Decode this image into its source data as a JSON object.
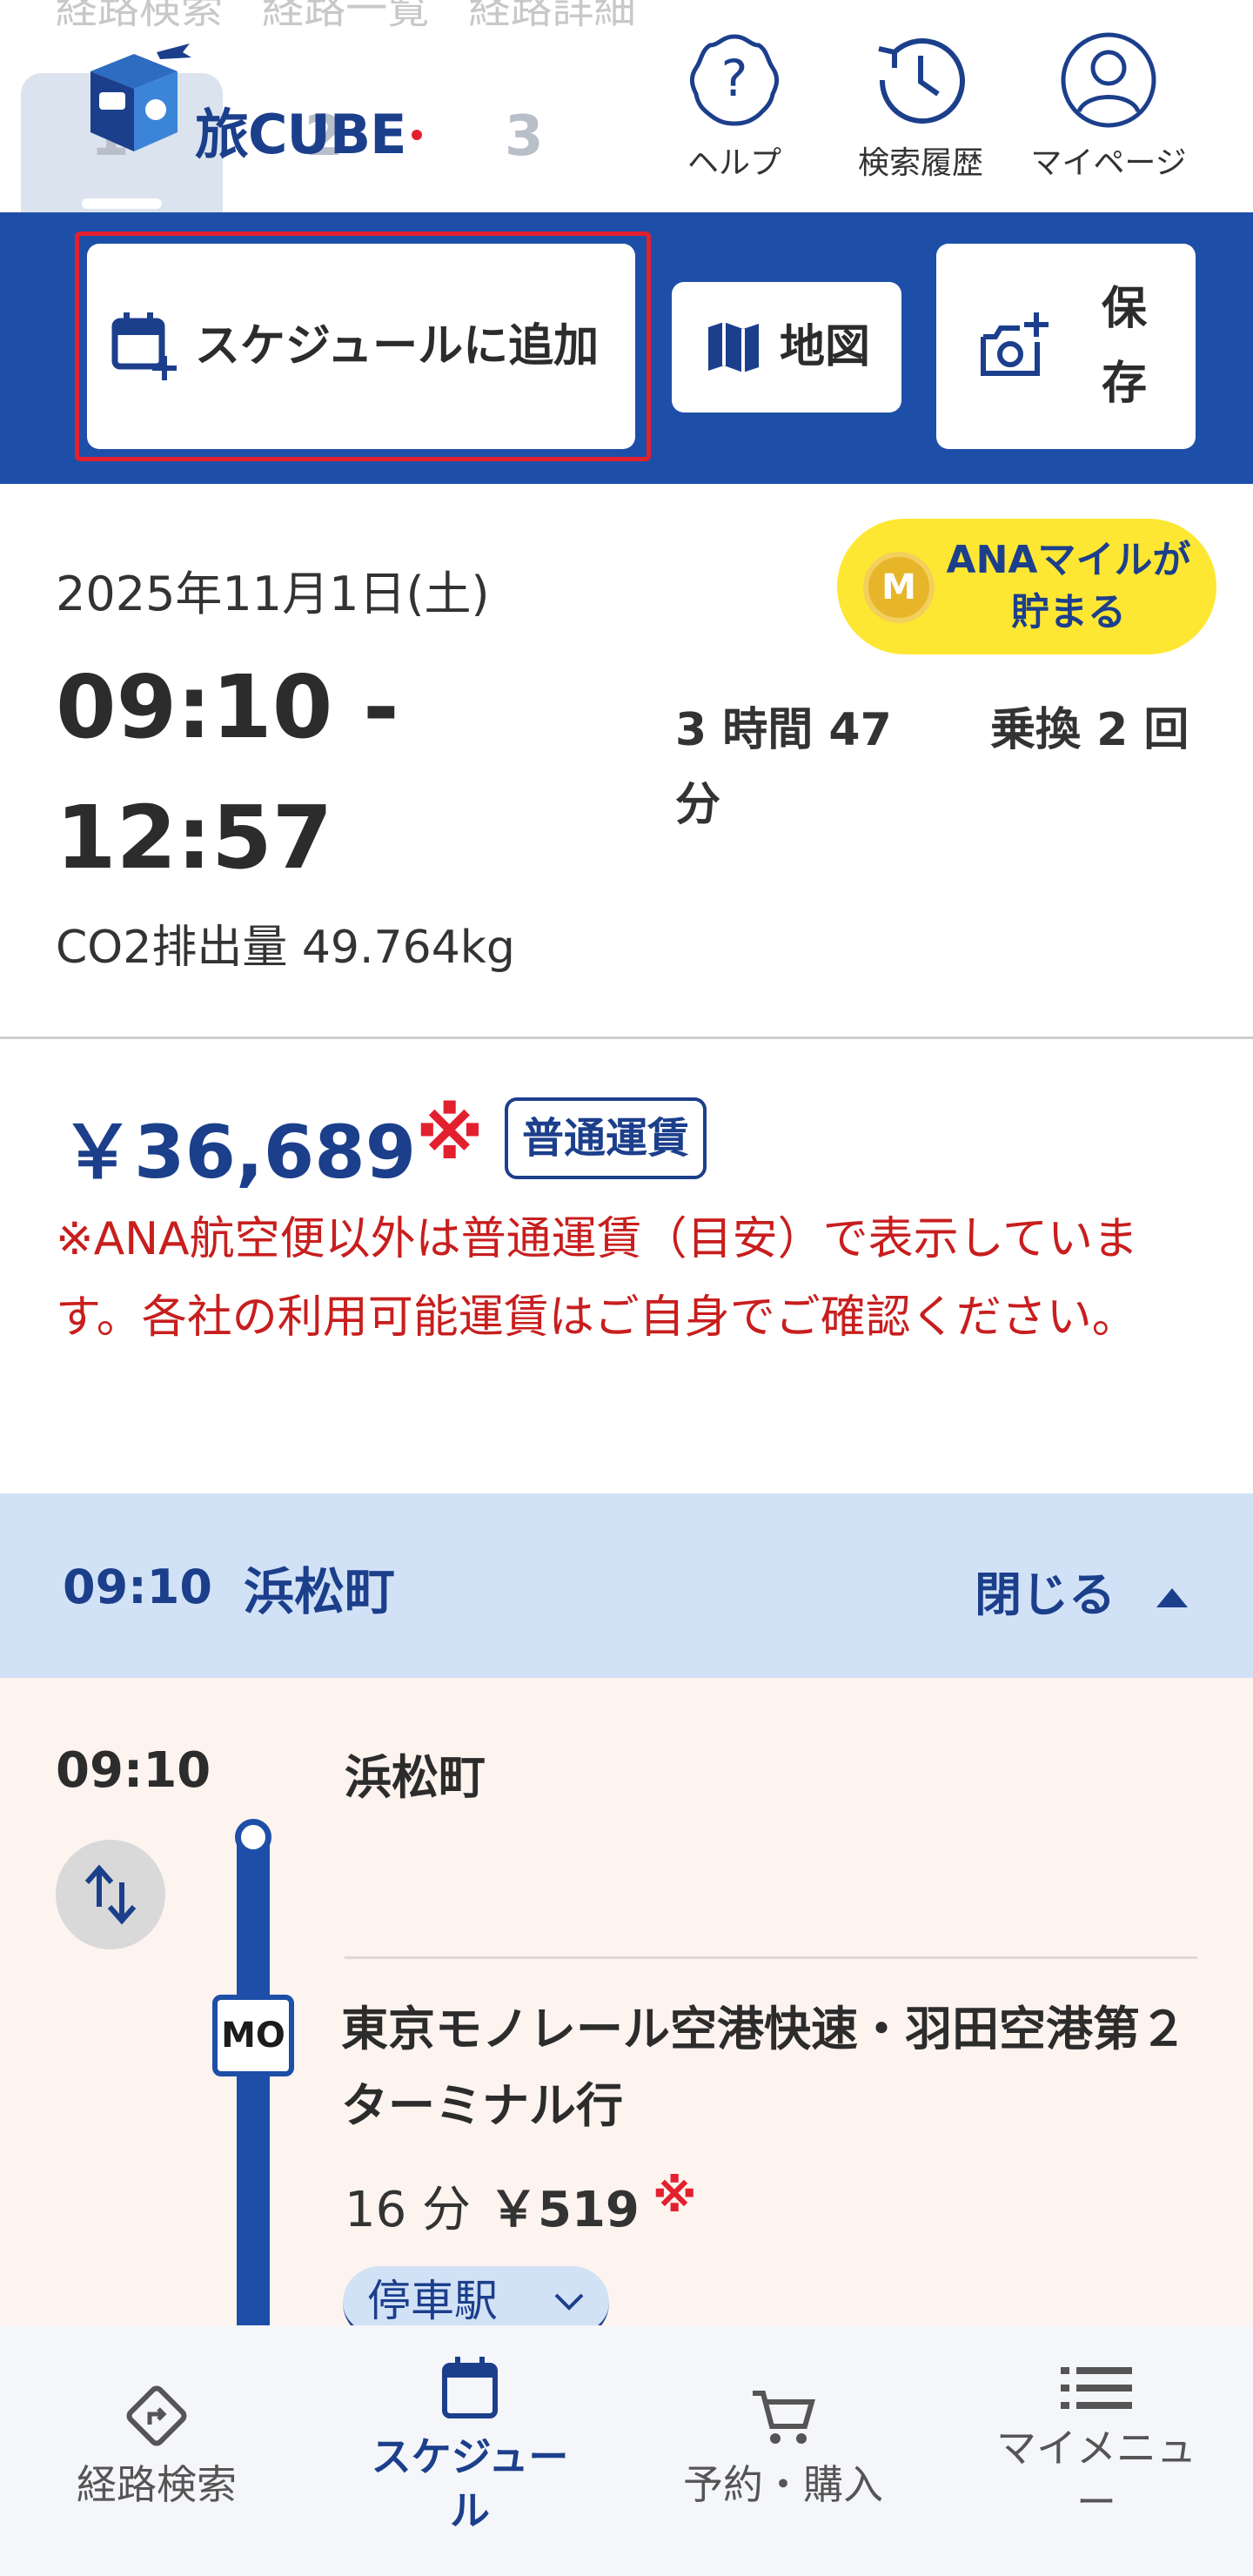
{
  "header": {
    "breadcrumb": [
      "経路検索",
      "経路一覧",
      "経路詳細"
    ],
    "steps": [
      "1",
      "2",
      "3"
    ],
    "logo_text": "旅CUBE",
    "help_label": "ヘルプ",
    "history_label": "検索履歴",
    "mypage_label": "マイページ"
  },
  "actions": {
    "schedule_label": "スケジュールに追加",
    "map_label": "地図",
    "save_label": "保存"
  },
  "summary": {
    "date": "2025年11月1日(土)",
    "time_range": "09:10 - 12:57",
    "duration": "3 時間 47 分",
    "transfers": "乗換 2 回",
    "co2": "CO2排出量 49.764kg",
    "ana_badge": "ANAマイルが貯まる",
    "ana_coin": "M"
  },
  "fare": {
    "price": "￥36,689",
    "mark": "※",
    "fare_type": "普通運賃",
    "note": "※ANA航空便以外は普通運賃（目安）で表示しています。各社の利用可能運賃はご自身でご確認ください。"
  },
  "section": {
    "time": "09:10",
    "station": "浜松町",
    "close_label": "閉じる"
  },
  "route": {
    "time": "09:10",
    "station": "浜松町",
    "line_code": "MO",
    "train_name": "東京モノレール空港快速・羽田空港第２ターミナル行",
    "minutes": "16 分",
    "fare": "￥519",
    "mark": "※",
    "stops_label": "停車駅"
  },
  "bottom_nav": {
    "search": "経路検索",
    "schedule": "スケジュール",
    "purchase": "予約・購入",
    "menu": "マイメニュー"
  },
  "colors": {
    "primary": "#1e4fa8",
    "navy": "#1c3f8c",
    "alert": "#e3202e",
    "badge": "#fde732"
  }
}
